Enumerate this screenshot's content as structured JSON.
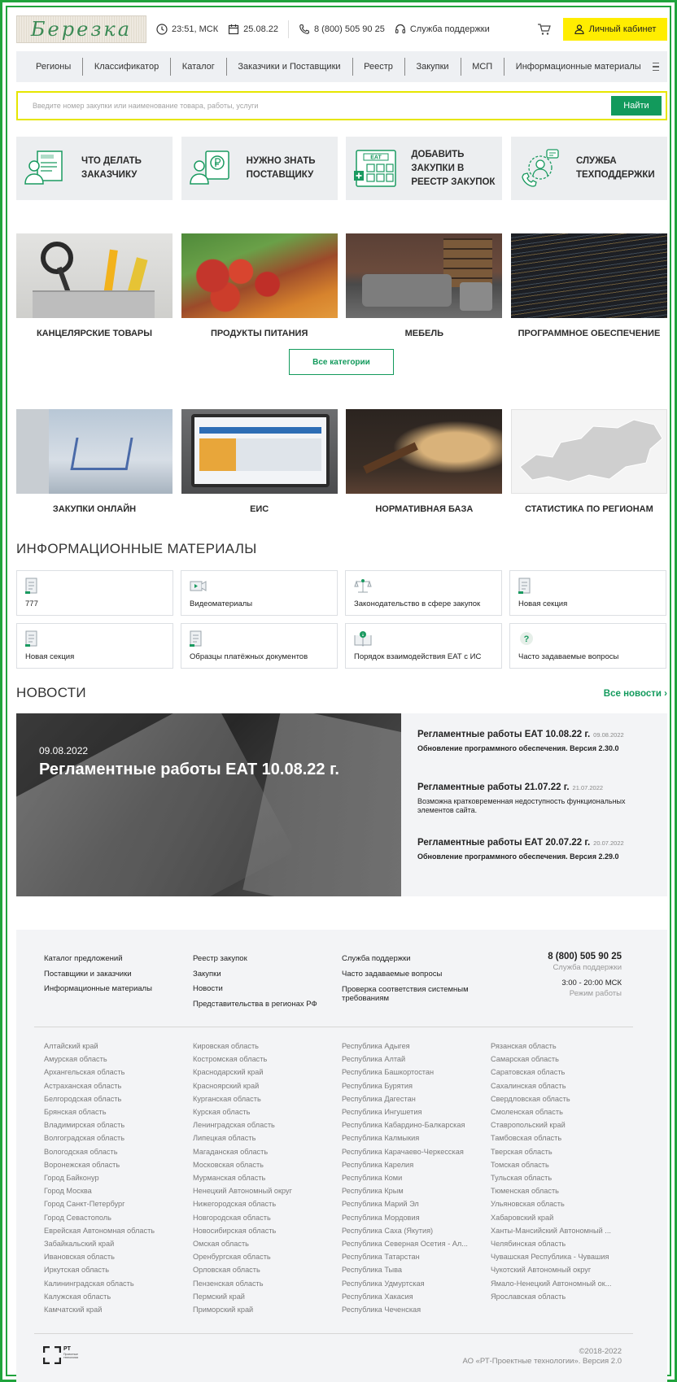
{
  "header": {
    "logo_text": "Березка",
    "time": "23:51, МСК",
    "date": "25.08.22",
    "phone": "8 (800) 505 90 25",
    "support": "Служба поддержки",
    "cabinet": "Личный кабинет"
  },
  "nav": [
    "Регионы",
    "Классификатор",
    "Каталог",
    "Заказчики и Поставщики",
    "Реестр",
    "Закупки",
    "МСП",
    "Информационные материалы"
  ],
  "search": {
    "placeholder": "Введите номер закупки или наименование товара, работы, услуги",
    "button": "Найти"
  },
  "tiles": [
    {
      "label": "Что делать заказчику",
      "icon": "customer-document-icon"
    },
    {
      "label": "Нужно знать поставщику",
      "icon": "supplier-ruble-icon"
    },
    {
      "label": "Добавить закупки в реестр закупок",
      "icon": "eat-registry-icon",
      "icon_text": "EAT"
    },
    {
      "label": "Служба техподдержки",
      "icon": "support-headset-icon"
    }
  ],
  "categories": [
    "КАНЦЕЛЯРСКИЕ ТОВАРЫ",
    "ПРОДУКТЫ ПИТАНИЯ",
    "МЕБЕЛЬ",
    "ПРОГРАММНОЕ ОБЕСПЕЧЕНИЕ"
  ],
  "all_categories": "Все категории",
  "services": [
    "ЗАКУПКИ ОНЛАЙН",
    "ЕИС",
    "НОРМАТИВНАЯ БАЗА",
    "СТАТИСТИКА ПО РЕГИОНАМ"
  ],
  "info_title": "ИНФОРМАЦИОННЫЕ МАТЕРИАЛЫ",
  "info_items": [
    {
      "label": "777",
      "icon": "document-icon"
    },
    {
      "label": "Видеоматериалы",
      "icon": "video-icon"
    },
    {
      "label": "Законодательство в сфере закупок",
      "icon": "scales-icon"
    },
    {
      "label": "Новая секция",
      "icon": "document-icon"
    },
    {
      "label": "Новая секция",
      "icon": "document-icon"
    },
    {
      "label": "Образцы платёжных документов",
      "icon": "document-icon"
    },
    {
      "label": "Порядок взаимодействия ЕАТ с ИС",
      "icon": "book-info-icon"
    },
    {
      "label": "Часто задаваемые вопросы",
      "icon": "question-icon"
    }
  ],
  "news_title": "НОВОСТИ",
  "all_news": "Все новости",
  "news_hero": {
    "date": "09.08.2022",
    "title": "Регламентные работы ЕАТ 10.08.22 г."
  },
  "news": [
    {
      "title": "Регламентные работы ЕАТ 10.08.22 г.",
      "date": "09.08.2022",
      "text": "Обновление программного обеспечения. Версия 2.30.0",
      "bold": true
    },
    {
      "title": "Регламентные работы 21.07.22 г.",
      "date": "21.07.2022",
      "text": "Возможна кратковременная недоступность функциональных элементов сайта.",
      "bold": false
    },
    {
      "title": "Регламентные работы ЕАТ 20.07.22 г.",
      "date": "20.07.2022",
      "text": "Обновление программного обеспечения. Версия 2.29.0",
      "bold": true
    }
  ],
  "footer": {
    "col1": [
      "Каталог предложений",
      "Поставщики и заказчики",
      "Информационные материалы"
    ],
    "col2": [
      "Реестр закупок",
      "Закупки",
      "Новости",
      "Представительства в регионах РФ"
    ],
    "col3": [
      "Служба поддержки",
      "Часто задаваемые вопросы",
      "Проверка соответствия системным требованиям"
    ],
    "phone": "8 (800) 505 90 25",
    "phone_caption": "Служба поддержки",
    "hours": "3:00 - 20:00 МСК",
    "hours_caption": "Режим работы",
    "regions": [
      [
        "Алтайский край",
        "Амурская область",
        "Архангельская область",
        "Астраханская область",
        "Белгородская область",
        "Брянская область",
        "Владимирская область",
        "Волгоградская область",
        "Вологодская область",
        "Воронежская область",
        "Город Байконур",
        "Город Москва",
        "Город Санкт-Петербург",
        "Город Севастополь",
        "Еврейская Автономная область",
        "Забайкальский край",
        "Ивановская область",
        "Иркутская область",
        "Калининградская область",
        "Калужская область",
        "Камчатский край"
      ],
      [
        "Кировская область",
        "Костромская область",
        "Краснодарский край",
        "Красноярский край",
        "Курганская область",
        "Курская область",
        "Ленинградская область",
        "Липецкая область",
        "Магаданская область",
        "Московская область",
        "Мурманская область",
        "Ненецкий Автономный округ",
        "Нижегородская область",
        "Новгородская область",
        "Новосибирская область",
        "Омская область",
        "Оренбургская область",
        "Орловская область",
        "Пензенская область",
        "Пермский край",
        "Приморский край"
      ],
      [
        "Республика Адыгея",
        "Республика Алтай",
        "Республика Башкортостан",
        "Республика Бурятия",
        "Республика Дагестан",
        "Республика Ингушетия",
        "Республика Кабардино-Балкарская",
        "Республика Калмыкия",
        "Республика Карачаево-Черкесская",
        "Республика Карелия",
        "Республика Коми",
        "Республика Крым",
        "Республика Марий Эл",
        "Республика Мордовия",
        "Республика Саха (Якутия)",
        "Республика Северная Осетия - Ал...",
        "Республика Татарстан",
        "Республика Тыва",
        "Республика Удмуртская",
        "Республика Хакасия",
        "Республика Чеченская"
      ],
      [
        "Рязанская область",
        "Самарская область",
        "Саратовская область",
        "Сахалинская область",
        "Свердловская область",
        "Смоленская область",
        "Ставропольский край",
        "Тамбовская область",
        "Тверская область",
        "Томская область",
        "Тульская область",
        "Тюменская область",
        "Ульяновская область",
        "Хабаровский край",
        "Ханты-Мансийский Автономный ...",
        "Челябинская область",
        "Чувашская Республика - Чувашия",
        "Чукотский Автономный округ",
        "Ямало-Ненецкий Автономный ок...",
        "Ярославская область"
      ]
    ],
    "rt_logo": "РТ",
    "rt_sub": "Проектные технологии",
    "copyright": "©2018-2022",
    "company": "АО «РТ-Проектные технологии». Версия 2.0"
  },
  "colors": {
    "accent": "#129a5c",
    "cabinet": "#ffed00",
    "frame": "#1fa33c"
  }
}
